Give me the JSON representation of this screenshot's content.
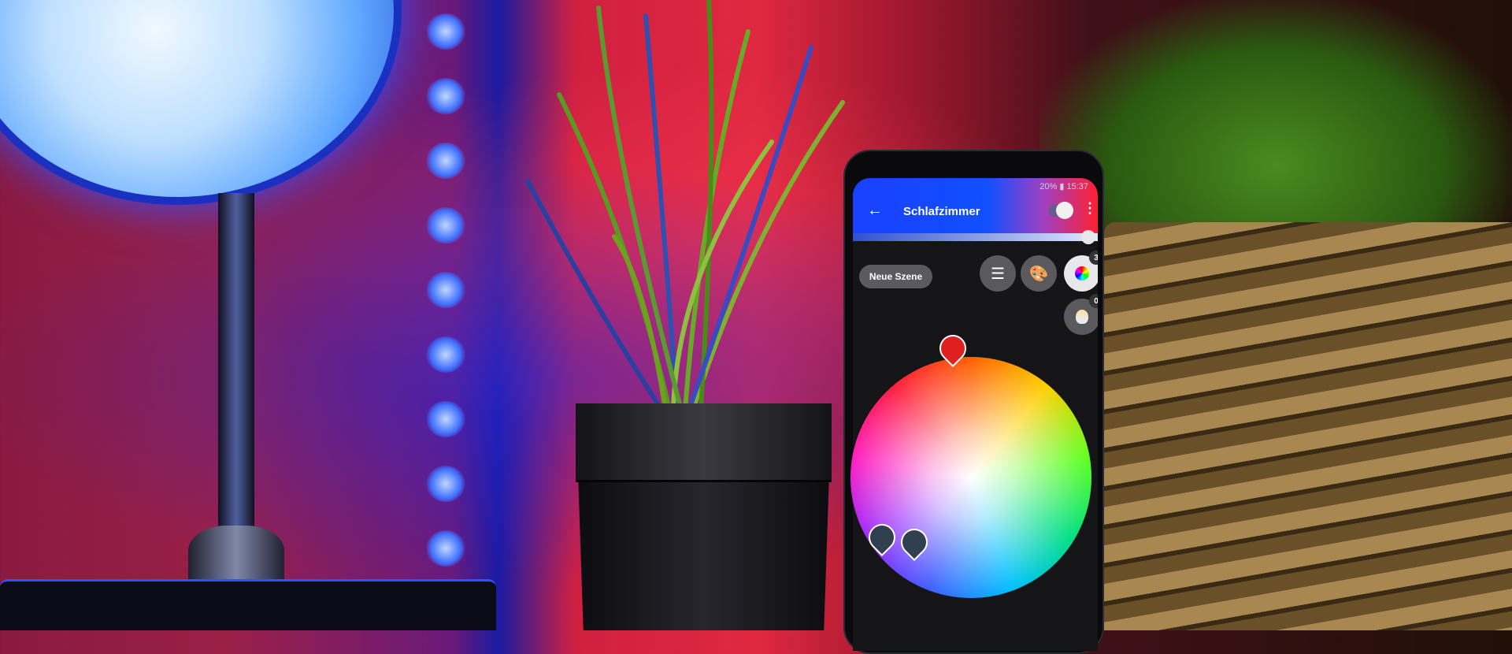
{
  "phone_app": {
    "status_bar": {
      "battery": "20%",
      "time": "15:37"
    },
    "header": {
      "title": "Schlafzimmer",
      "back_icon": "arrow-left-icon",
      "menu_icon": "more-vert-icon"
    },
    "new_scene_label": "Neue Szene",
    "color_lights_count": "3",
    "white_lights_count": "0",
    "brightness_percent": 100,
    "accent_colors": {
      "header_start": "#1a40ff",
      "header_end": "#ff2030"
    }
  }
}
